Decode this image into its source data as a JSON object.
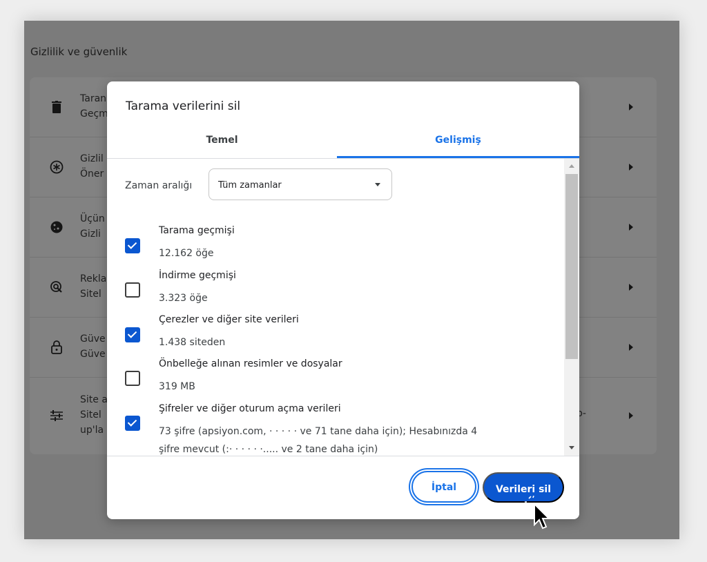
{
  "background": {
    "section_title": "Gizlilik ve güvenlik",
    "rows": [
      {
        "icon": "trash-icon",
        "line1": "Taran",
        "line2": "Geçm"
      },
      {
        "icon": "privacy-guide-icon",
        "line1": "Gizlil",
        "line2": "Öner"
      },
      {
        "icon": "cookie-icon",
        "line1": "Üçün",
        "line2": "Gizli"
      },
      {
        "icon": "ads-privacy-icon",
        "line1": "Rekla",
        "line2": "Sitel"
      },
      {
        "icon": "lock-icon",
        "line1": "Güve",
        "line2": "Güve"
      },
      {
        "icon": "sliders-icon",
        "line1": "Site a",
        "line2": "Sitel",
        "line3": "up'la",
        "tail": "p-"
      }
    ]
  },
  "dialog": {
    "title": "Tarama verilerini sil",
    "tabs": {
      "basic": "Temel",
      "advanced": "Gelişmiş"
    },
    "time_range": {
      "label": "Zaman aralığı",
      "value": "Tüm zamanlar"
    },
    "options": [
      {
        "title": "Tarama geçmişi",
        "desc": "12.162 öğe",
        "checked": true
      },
      {
        "title": "İndirme geçmişi",
        "desc": "3.323 öğe",
        "checked": false
      },
      {
        "title": "Çerezler ve diğer site verileri",
        "desc": "1.438 siteden",
        "checked": true
      },
      {
        "title": "Önbelleğe alınan resimler ve dosyalar",
        "desc": "319 MB",
        "checked": false
      },
      {
        "title": "Şifreler ve diğer oturum açma verileri",
        "desc": "73 şifre (apsiyon.com, ·   ·   ·   ·   · ve 71 tane daha için); Hesabınızda 4",
        "desc2": "şifre mevcut (:· ·   ·   ·   ·  ·..... ve 2 tane daha için)",
        "checked": true
      }
    ],
    "buttons": {
      "cancel": "İptal",
      "delete": "Verileri sil"
    }
  },
  "colors": {
    "accent": "#1a73e8",
    "primary_button": "#0b57d0",
    "overlay": "#7b7b7b"
  }
}
